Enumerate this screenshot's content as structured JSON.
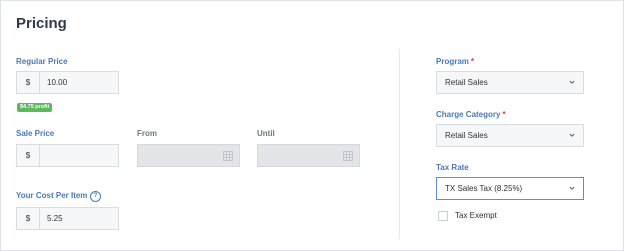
{
  "section": {
    "title": "Pricing"
  },
  "regular_price": {
    "label": "Regular Price",
    "currency": "$",
    "value": "10.00",
    "profit_badge": "$4.75 profit"
  },
  "sale_price": {
    "label": "Sale Price",
    "currency": "$",
    "value": ""
  },
  "from": {
    "label": "From",
    "value": ""
  },
  "until": {
    "label": "Until",
    "value": ""
  },
  "cost_per_item": {
    "label": "Your Cost Per Item",
    "help": "?",
    "currency": "$",
    "value": "5.25"
  },
  "program": {
    "label": "Program",
    "required_mark": "*",
    "value": "Retail Sales"
  },
  "charge_category": {
    "label": "Charge Category",
    "required_mark": "*",
    "value": "Retail Sales"
  },
  "tax_rate": {
    "label": "Tax Rate",
    "value": "TX Sales Tax (8.25%)"
  },
  "tax_exempt": {
    "label": "Tax Exempt",
    "checked": false
  },
  "icons": {
    "calendar": "calendar-icon",
    "chevron": "chevron-down-icon",
    "help": "help-icon"
  },
  "colors": {
    "label_blue": "#4a7ab0",
    "profit_green": "#5cb85c",
    "required_red": "#e03a3a",
    "focus_blue": "#5b8ed6"
  }
}
